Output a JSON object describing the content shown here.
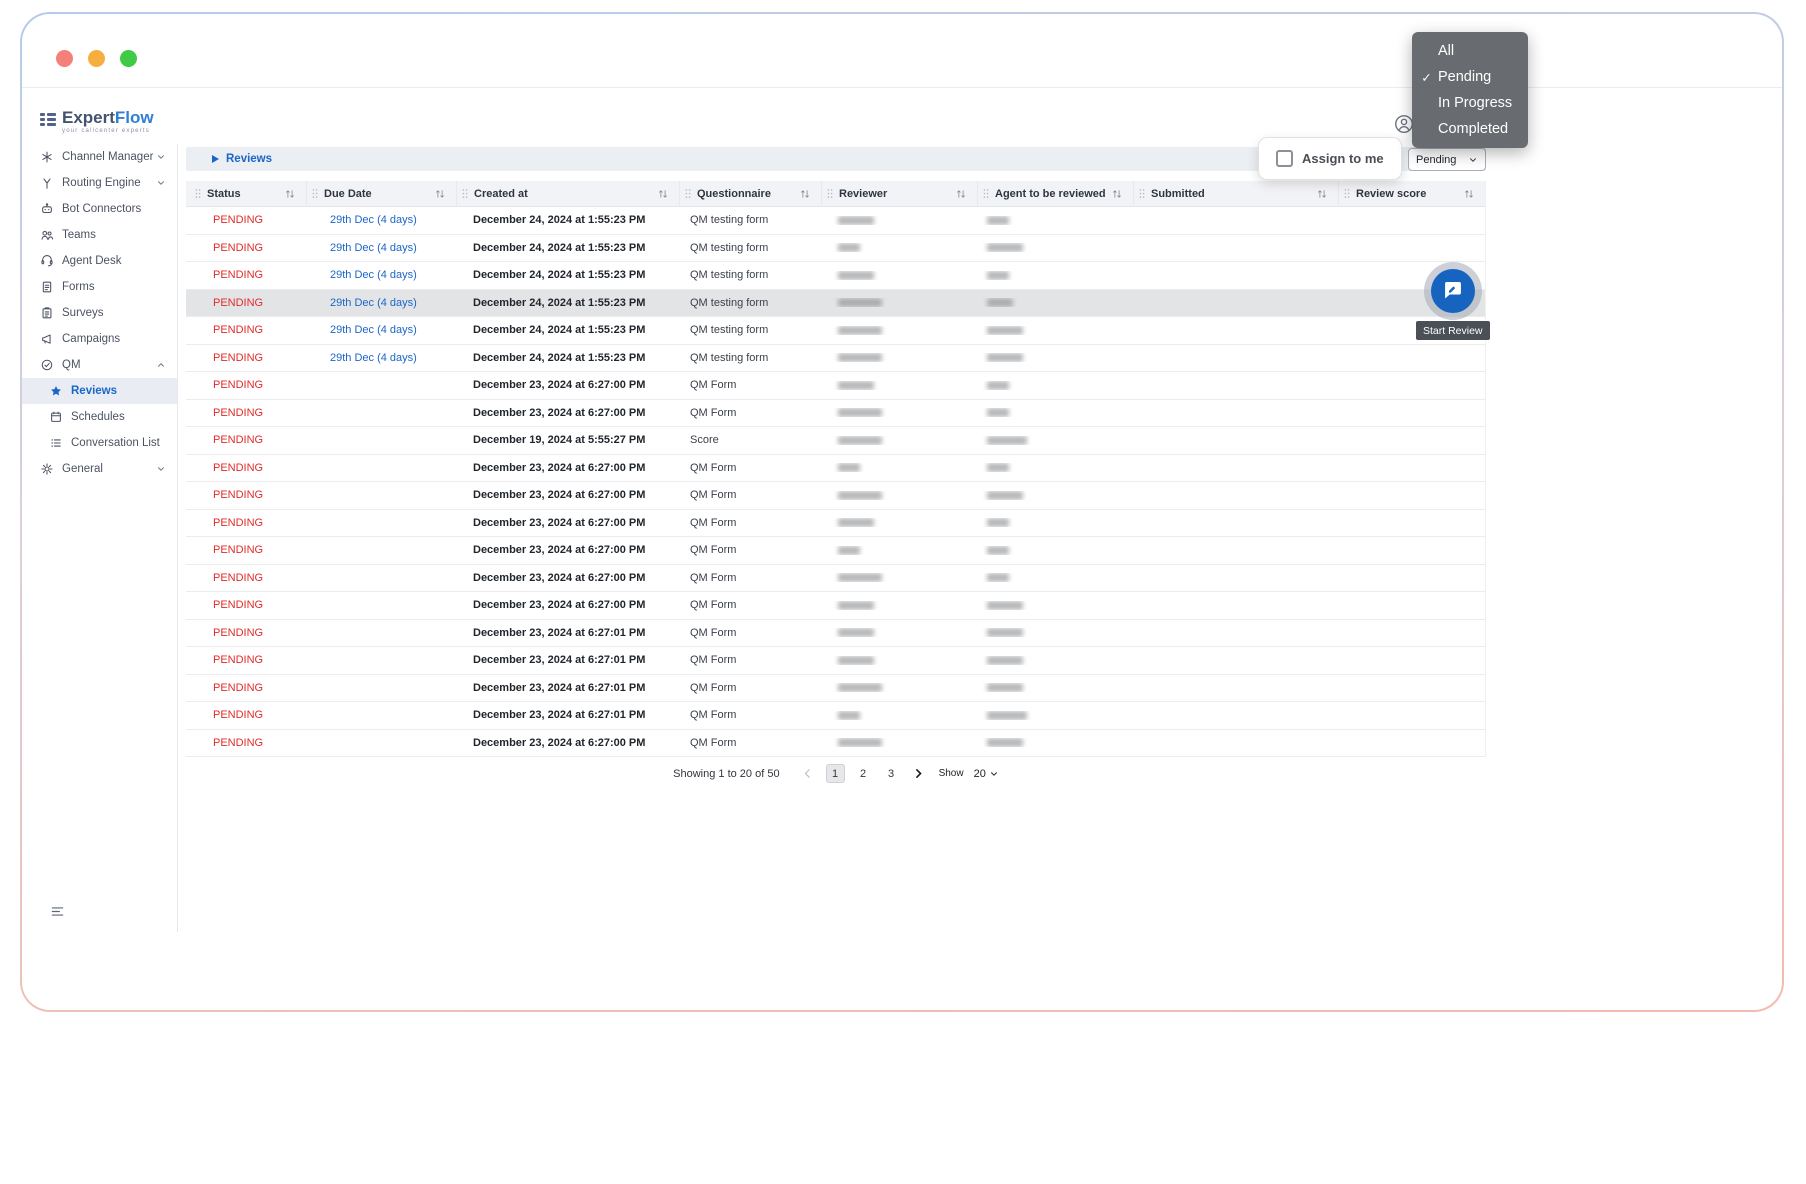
{
  "colors": {
    "accent_blue": "#1b66c9",
    "pending_red": "#e02b2b",
    "link_blue": "#1b66c9",
    "menu_dark": "#5c6064",
    "row_highlight": "#e3e4e6"
  },
  "brand": {
    "name_bold": "Expert",
    "name_accent": "Flow",
    "tagline": "your callcenter experts"
  },
  "filter_menu": {
    "items": [
      {
        "label": "All",
        "checked": false
      },
      {
        "label": "Pending",
        "checked": true
      },
      {
        "label": "In Progress",
        "checked": false
      },
      {
        "label": "Completed",
        "checked": false
      }
    ]
  },
  "sidebar": {
    "items": [
      {
        "label": "Channel Manager",
        "icon": "channel-manager",
        "chevron": "down"
      },
      {
        "label": "Routing Engine",
        "icon": "routing-engine",
        "chevron": "down"
      },
      {
        "label": "Bot Connectors",
        "icon": "bot-connectors"
      },
      {
        "label": "Teams",
        "icon": "teams"
      },
      {
        "label": "Agent Desk",
        "icon": "agent-desk"
      },
      {
        "label": "Forms",
        "icon": "forms"
      },
      {
        "label": "Surveys",
        "icon": "surveys"
      },
      {
        "label": "Campaigns",
        "icon": "campaigns"
      },
      {
        "label": "QM",
        "icon": "qm",
        "chevron": "up"
      },
      {
        "label": "Reviews",
        "icon": "reviews",
        "indent": true,
        "active": true
      },
      {
        "label": "Schedules",
        "icon": "schedules",
        "indent": true
      },
      {
        "label": "Conversation List",
        "icon": "conversation-list",
        "indent": true
      },
      {
        "label": "General",
        "icon": "general",
        "chevron": "down"
      }
    ]
  },
  "breadcrumb": {
    "label": "Reviews"
  },
  "controls": {
    "assign_label": "Assign to me",
    "assign_checked": false,
    "status_filter_value": "Pending"
  },
  "table": {
    "columns": [
      "Status",
      "Due Date",
      "Created at",
      "Questionnaire",
      "Reviewer",
      "Agent to be reviewed",
      "Submitted",
      "Review score"
    ],
    "rows": [
      {
        "status": "PENDING",
        "due": "29th Dec (4 days)",
        "created": "December 24, 2024 at 1:55:23 PM",
        "questionnaire": "QM testing form",
        "reviewer_w": 36,
        "agent_w": 22,
        "highlighted": false
      },
      {
        "status": "PENDING",
        "due": "29th Dec (4 days)",
        "created": "December 24, 2024 at 1:55:23 PM",
        "questionnaire": "QM testing form",
        "reviewer_w": 22,
        "agent_w": 36,
        "highlighted": false
      },
      {
        "status": "PENDING",
        "due": "29th Dec (4 days)",
        "created": "December 24, 2024 at 1:55:23 PM",
        "questionnaire": "QM testing form",
        "reviewer_w": 36,
        "agent_w": 22,
        "highlighted": false
      },
      {
        "status": "PENDING",
        "due": "29th Dec (4 days)",
        "created": "December 24, 2024 at 1:55:23 PM",
        "questionnaire": "QM testing form",
        "reviewer_w": 44,
        "agent_w": 26,
        "highlighted": true
      },
      {
        "status": "PENDING",
        "due": "29th Dec (4 days)",
        "created": "December 24, 2024 at 1:55:23 PM",
        "questionnaire": "QM testing form",
        "reviewer_w": 44,
        "agent_w": 36,
        "highlighted": false
      },
      {
        "status": "PENDING",
        "due": "29th Dec (4 days)",
        "created": "December 24, 2024 at 1:55:23 PM",
        "questionnaire": "QM testing form",
        "reviewer_w": 44,
        "agent_w": 36,
        "highlighted": false
      },
      {
        "status": "PENDING",
        "due": "",
        "created": "December 23, 2024 at 6:27:00 PM",
        "questionnaire": "QM Form",
        "reviewer_w": 36,
        "agent_w": 22,
        "highlighted": false
      },
      {
        "status": "PENDING",
        "due": "",
        "created": "December 23, 2024 at 6:27:00 PM",
        "questionnaire": "QM Form",
        "reviewer_w": 44,
        "agent_w": 22,
        "highlighted": false
      },
      {
        "status": "PENDING",
        "due": "",
        "created": "December 19, 2024 at 5:55:27 PM",
        "questionnaire": "Score",
        "reviewer_w": 44,
        "agent_w": 40,
        "highlighted": false
      },
      {
        "status": "PENDING",
        "due": "",
        "created": "December 23, 2024 at 6:27:00 PM",
        "questionnaire": "QM Form",
        "reviewer_w": 22,
        "agent_w": 22,
        "highlighted": false
      },
      {
        "status": "PENDING",
        "due": "",
        "created": "December 23, 2024 at 6:27:00 PM",
        "questionnaire": "QM Form",
        "reviewer_w": 44,
        "agent_w": 36,
        "highlighted": false
      },
      {
        "status": "PENDING",
        "due": "",
        "created": "December 23, 2024 at 6:27:00 PM",
        "questionnaire": "QM Form",
        "reviewer_w": 36,
        "agent_w": 22,
        "highlighted": false
      },
      {
        "status": "PENDING",
        "due": "",
        "created": "December 23, 2024 at 6:27:00 PM",
        "questionnaire": "QM Form",
        "reviewer_w": 22,
        "agent_w": 22,
        "highlighted": false
      },
      {
        "status": "PENDING",
        "due": "",
        "created": "December 23, 2024 at 6:27:00 PM",
        "questionnaire": "QM Form",
        "reviewer_w": 44,
        "agent_w": 22,
        "highlighted": false
      },
      {
        "status": "PENDING",
        "due": "",
        "created": "December 23, 2024 at 6:27:00 PM",
        "questionnaire": "QM Form",
        "reviewer_w": 36,
        "agent_w": 36,
        "highlighted": false
      },
      {
        "status": "PENDING",
        "due": "",
        "created": "December 23, 2024 at 6:27:01 PM",
        "questionnaire": "QM Form",
        "reviewer_w": 36,
        "agent_w": 36,
        "highlighted": false
      },
      {
        "status": "PENDING",
        "due": "",
        "created": "December 23, 2024 at 6:27:01 PM",
        "questionnaire": "QM Form",
        "reviewer_w": 36,
        "agent_w": 36,
        "highlighted": false
      },
      {
        "status": "PENDING",
        "due": "",
        "created": "December 23, 2024 at 6:27:01 PM",
        "questionnaire": "QM Form",
        "reviewer_w": 44,
        "agent_w": 36,
        "highlighted": false
      },
      {
        "status": "PENDING",
        "due": "",
        "created": "December 23, 2024 at 6:27:01 PM",
        "questionnaire": "QM Form",
        "reviewer_w": 22,
        "agent_w": 40,
        "highlighted": false
      },
      {
        "status": "PENDING",
        "due": "",
        "created": "December 23, 2024 at 6:27:00 PM",
        "questionnaire": "QM Form",
        "reviewer_w": 44,
        "agent_w": 36,
        "highlighted": false
      }
    ]
  },
  "floating": {
    "tooltip": "Start Review"
  },
  "pagination": {
    "summary": "Showing 1 to 20 of 50",
    "pages": [
      "1",
      "2",
      "3"
    ],
    "active": "1",
    "show_label": "Show",
    "page_size": "20"
  }
}
